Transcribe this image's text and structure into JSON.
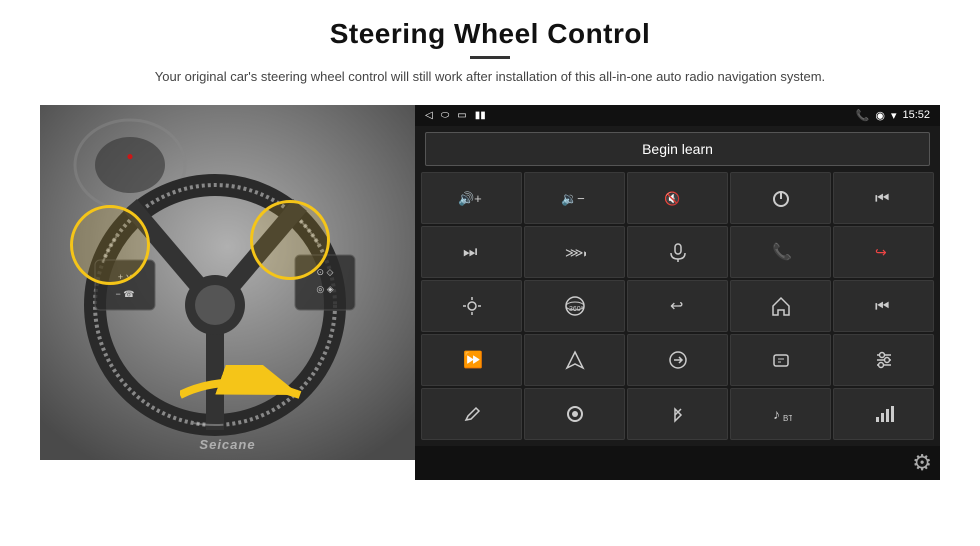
{
  "header": {
    "title": "Steering Wheel Control",
    "divider": true,
    "subtitle": "Your original car's steering wheel control will still work after installation of this all-in-one auto radio navigation system."
  },
  "status_bar": {
    "left_icons": [
      "back-icon",
      "home-icon",
      "square-icon",
      "signal-icon"
    ],
    "right_icons": [
      "phone-icon",
      "wifi-icon",
      "signal-bars-icon"
    ],
    "time": "15:52"
  },
  "begin_learn_btn": {
    "label": "Begin learn"
  },
  "controls": [
    {
      "icon": "vol-up",
      "symbol": "🔊+"
    },
    {
      "icon": "vol-down",
      "symbol": "🔉−"
    },
    {
      "icon": "mute",
      "symbol": "🔇×"
    },
    {
      "icon": "power",
      "symbol": "⏻"
    },
    {
      "icon": "prev-track",
      "symbol": "⏮"
    },
    {
      "icon": "next-track-skip",
      "symbol": "⏭"
    },
    {
      "icon": "next-skip2",
      "symbol": "⏭"
    },
    {
      "icon": "mic",
      "symbol": "🎤"
    },
    {
      "icon": "phone",
      "symbol": "📞"
    },
    {
      "icon": "hang-up",
      "symbol": "📵"
    },
    {
      "icon": "brightness",
      "symbol": "🔆"
    },
    {
      "icon": "360-view",
      "symbol": "360°"
    },
    {
      "icon": "back-nav",
      "symbol": "↩"
    },
    {
      "icon": "home-nav",
      "symbol": "⌂"
    },
    {
      "icon": "rewind",
      "symbol": "⏮"
    },
    {
      "icon": "fast-forward",
      "symbol": "⏩"
    },
    {
      "icon": "navigate",
      "symbol": "▲"
    },
    {
      "icon": "swap",
      "symbol": "⇄"
    },
    {
      "icon": "record",
      "symbol": "🖹"
    },
    {
      "icon": "equalizer",
      "symbol": "🎚"
    },
    {
      "icon": "pen",
      "symbol": "✏"
    },
    {
      "icon": "power2",
      "symbol": "⏺"
    },
    {
      "icon": "bluetooth",
      "symbol": "⚡"
    },
    {
      "icon": "music",
      "symbol": "♪"
    },
    {
      "icon": "bars",
      "symbol": "|||"
    }
  ],
  "watermark": {
    "text": "Seicane"
  },
  "gear_icon": {
    "symbol": "⚙"
  }
}
